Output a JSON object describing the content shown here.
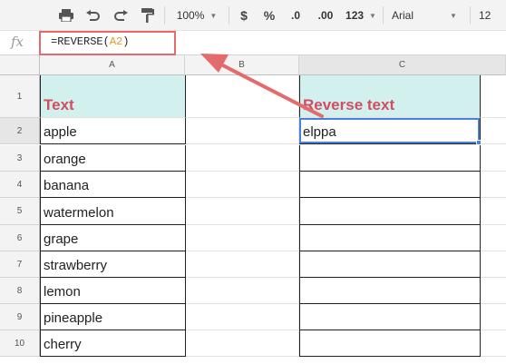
{
  "toolbar": {
    "zoom": "100%",
    "currency": "$",
    "percent": "%",
    "decrease_decimal": ".0",
    "increase_decimal": ".00",
    "more_formats": "123",
    "font": "Arial",
    "font_size": "12"
  },
  "formula_bar": {
    "fx": "fx",
    "prefix": "=REVERSE(",
    "ref": "A2",
    "suffix": ")"
  },
  "columns": [
    "A",
    "B",
    "C"
  ],
  "rows": [
    "1",
    "2",
    "3",
    "4",
    "5",
    "6",
    "7",
    "8",
    "9",
    "10"
  ],
  "colA": [
    "Text",
    "apple",
    "orange",
    "banana",
    "watermelon",
    "grape",
    "strawberry",
    "lemon",
    "pineapple",
    "cherry"
  ],
  "colC": [
    "Reverse text",
    "elppa",
    "",
    "",
    "",
    "",
    "",
    "",
    "",
    ""
  ],
  "colors": {
    "header_fill": "#d2f1ee",
    "header_text": "#d34d61",
    "annotation": "#e36b6b",
    "selection": "#4a7fdd"
  },
  "icons": [
    "print-icon",
    "undo-icon",
    "redo-icon",
    "paint-format-icon"
  ]
}
